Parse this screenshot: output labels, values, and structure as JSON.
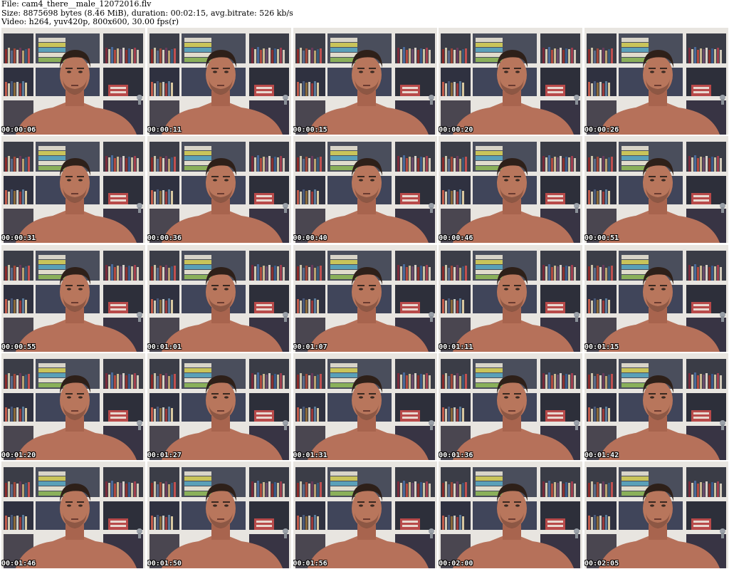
{
  "header": {
    "file_line": "File: cam4_there__male_12072016.flv",
    "size_line": "Size: 8875698 bytes (8.46 MiB), duration: 00:02:15, avg.bitrate: 526 kb/s",
    "video_line": "Video: h264, yuv420p, 800x600, 30.00 fps(r)"
  },
  "thumbnails": [
    {
      "timestamp": "00:00:06"
    },
    {
      "timestamp": "00:00:11"
    },
    {
      "timestamp": "00:00:15"
    },
    {
      "timestamp": "00:00:20"
    },
    {
      "timestamp": "00:00:26"
    },
    {
      "timestamp": "00:00:31"
    },
    {
      "timestamp": "00:00:36"
    },
    {
      "timestamp": "00:00:40"
    },
    {
      "timestamp": "00:00:46"
    },
    {
      "timestamp": "00:00:51"
    },
    {
      "timestamp": "00:00:55"
    },
    {
      "timestamp": "00:01:01"
    },
    {
      "timestamp": "00:01:07"
    },
    {
      "timestamp": "00:01:11"
    },
    {
      "timestamp": "00:01:15"
    },
    {
      "timestamp": "00:01:20"
    },
    {
      "timestamp": "00:01:27"
    },
    {
      "timestamp": "00:01:31"
    },
    {
      "timestamp": "00:01:36"
    },
    {
      "timestamp": "00:01:42"
    },
    {
      "timestamp": "00:01:46"
    },
    {
      "timestamp": "00:01:50"
    },
    {
      "timestamp": "00:01:56"
    },
    {
      "timestamp": "00:02:00"
    },
    {
      "timestamp": "00:02:05"
    }
  ],
  "colors": {
    "background": "#ffffff",
    "header_text": "#000000",
    "timestamp_text": "#ffffff",
    "timestamp_outline": "#000000",
    "wall": "#d9d3cc",
    "shelf": "#e9e6e1",
    "skin": "#b9745a",
    "hair": "#2b1d16"
  }
}
